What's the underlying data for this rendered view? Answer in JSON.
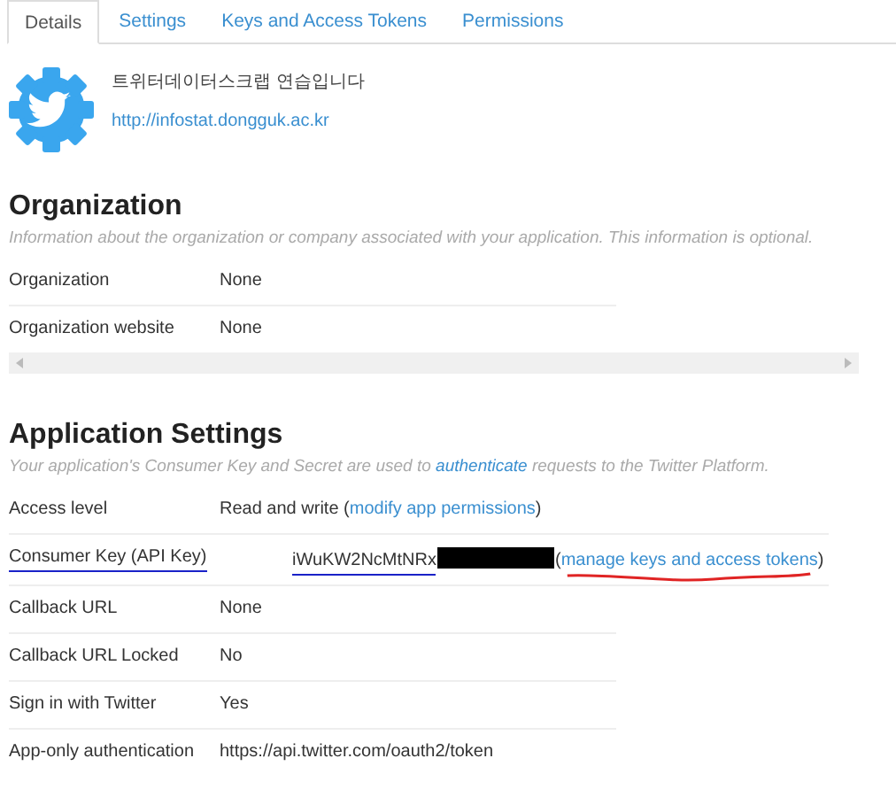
{
  "tabs": [
    {
      "label": "Details",
      "selected": true
    },
    {
      "label": "Settings",
      "selected": false
    },
    {
      "label": "Keys and Access Tokens",
      "selected": false
    },
    {
      "label": "Permissions",
      "selected": false
    }
  ],
  "app": {
    "name": "트위터데이터스크랩 연습입니다",
    "url": "http://infostat.dongguk.ac.kr"
  },
  "organization": {
    "title": "Organization",
    "description": "Information about the organization or company associated with your application. This information is optional.",
    "rows": [
      {
        "label": "Organization",
        "value": [
          {
            "kind": "text",
            "text": "None"
          }
        ]
      },
      {
        "label": "Organization website",
        "value": [
          {
            "kind": "text",
            "text": "None"
          }
        ]
      }
    ]
  },
  "application": {
    "title": "Application Settings",
    "description": [
      {
        "kind": "text",
        "text": "Your application's Consumer Key and Secret are used to "
      },
      {
        "kind": "link",
        "text": "authenticate"
      },
      {
        "kind": "text",
        "text": " requests to the Twitter Platform."
      }
    ],
    "rows": [
      {
        "label": "Access level",
        "kind": "plain",
        "value": [
          {
            "kind": "text",
            "text": "Read and write ("
          },
          {
            "kind": "link",
            "text": "modify app permissions"
          },
          {
            "kind": "text",
            "text": ")"
          }
        ]
      },
      {
        "label": "Consumer Key (API Key)",
        "kind": "key",
        "label_underline": {
          "color": "#1a22c8"
        },
        "value": [
          {
            "kind": "text",
            "text": "iWuKW2NcMtNRx",
            "color": "#1a22c8"
          },
          {
            "kind": "redacted"
          },
          {
            "kind": "text",
            "text": "("
          },
          {
            "kind": "link",
            "text": "manage keys and access tokens",
            "color": "#e02424"
          },
          {
            "kind": "text",
            "text": ")"
          }
        ]
      },
      {
        "label": "Callback URL",
        "kind": "plain",
        "value": [
          {
            "kind": "text",
            "text": "None"
          }
        ]
      },
      {
        "label": "Callback URL Locked",
        "kind": "plain",
        "value": [
          {
            "kind": "text",
            "text": "No"
          }
        ]
      },
      {
        "label": "Sign in with Twitter",
        "kind": "plain",
        "value": [
          {
            "kind": "text",
            "text": "Yes"
          }
        ]
      },
      {
        "label": "App-only authentication",
        "kind": "plain",
        "value": [
          {
            "kind": "text",
            "text": "https://api.twitter.com/oauth2/token"
          }
        ]
      }
    ]
  }
}
